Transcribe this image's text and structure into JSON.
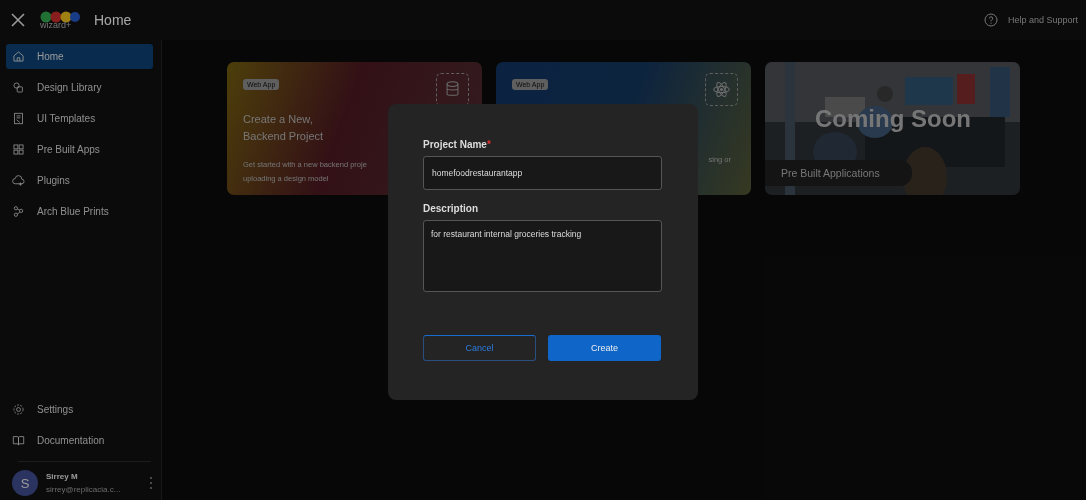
{
  "header": {
    "logo_text": "wizard+",
    "title": "Home",
    "help": "Help and Support"
  },
  "sidebar": {
    "items": [
      {
        "label": "Home",
        "selected": true
      },
      {
        "label": "Design Library",
        "selected": false
      },
      {
        "label": "UI Templates",
        "selected": false
      },
      {
        "label": "Pre Built Apps",
        "selected": false
      },
      {
        "label": "Plugins",
        "selected": false
      },
      {
        "label": "Arch Blue Prints",
        "selected": false
      }
    ],
    "bottom_items": [
      {
        "label": "Settings"
      },
      {
        "label": "Documentation"
      }
    ],
    "user": {
      "initial": "S",
      "name": "Sirrey M",
      "email": "sirrey@replicacia.c..."
    }
  },
  "cards": [
    {
      "kind": "backend",
      "badge": "Web App",
      "title": "Create a New,\nBackend Project",
      "description_lines": [
        "Get started with a new backend proje",
        "uploading a design model"
      ]
    },
    {
      "kind": "frontend",
      "badge": "Web App",
      "description_lines": [
        "sing or"
      ]
    },
    {
      "kind": "picture",
      "overlay_title": "Coming Soon",
      "label": "Pre Built Applications"
    }
  ],
  "dialog": {
    "name_label": "Project Name",
    "required_mark": "*",
    "name_value": "homefoodrestaurantapp",
    "description_label": "Description",
    "description_value": "for restaurant internal groceries tracking",
    "buttons": [
      {
        "label": "Cancel",
        "kind": "secondary"
      },
      {
        "label": "Create",
        "kind": "primary"
      }
    ]
  }
}
